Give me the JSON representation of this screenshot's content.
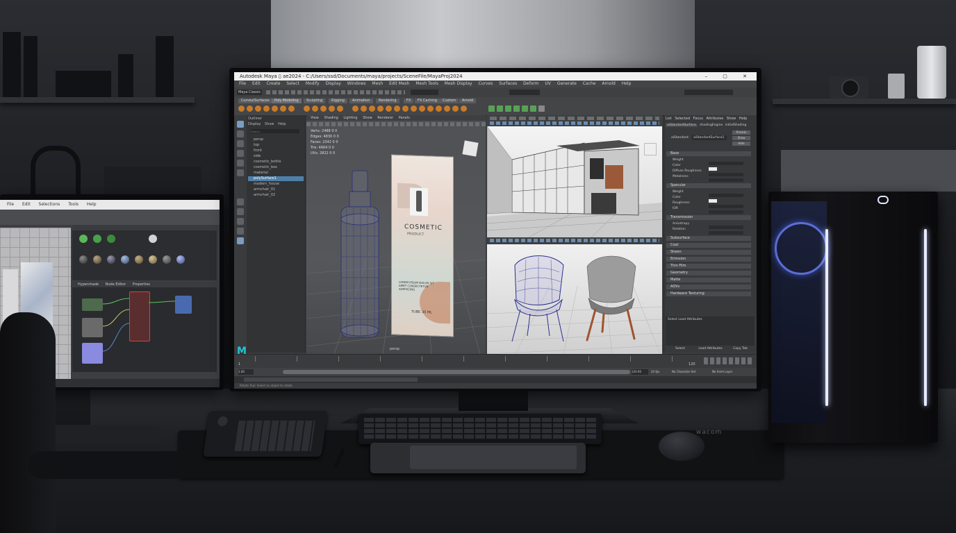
{
  "main_app": {
    "title_bar": "Autodesk Maya ▯ ae2024 - C:/Users/ssd/Documents/maya/projects/SceneFile/MayaProj2024",
    "window_controls": "–  ▢  ✕",
    "menus": [
      "File",
      "Edit",
      "Create",
      "Select",
      "Modify",
      "Display",
      "Windows",
      "Mesh",
      "Edit Mesh",
      "Mesh Tools",
      "Mesh Display",
      "Curves",
      "Surfaces",
      "Deform",
      "UV",
      "Generate",
      "Cache",
      "Arnold",
      "Help"
    ],
    "workspace": "Maya Classic",
    "shelf_tabs": [
      "Curves/Surfaces",
      "Poly Modeling",
      "Sculpting",
      "Rigging",
      "Animation",
      "Rendering",
      "FX",
      "FX Caching",
      "Custom",
      "Arnold",
      "Bifrost",
      "MASH",
      "Motion Graphics",
      "XGen"
    ],
    "logo": "M",
    "outliner": {
      "header": "Outliner",
      "menu": [
        "Display",
        "Show",
        "Help"
      ],
      "search_placeholder": "Search...",
      "items": [
        "persp",
        "top",
        "front",
        "side",
        "cosmetic_bottle",
        "cosmetic_box",
        "material",
        "polySurface1",
        "modern_house",
        "armchair_01",
        "armchair_02"
      ]
    },
    "viewport_menu": [
      "View",
      "Shading",
      "Lighting",
      "Show",
      "Renderer",
      "Panels"
    ],
    "hud_stats": [
      {
        "label": "Verts:",
        "v1": "2488",
        "v2": "0",
        "v3": "0"
      },
      {
        "label": "Edges:",
        "v1": "4830",
        "v2": "0",
        "v3": "0"
      },
      {
        "label": "Faces:",
        "v1": "2342",
        "v2": "0",
        "v3": "0"
      },
      {
        "label": "Tris:",
        "v1": "4664",
        "v2": "0",
        "v3": "0"
      },
      {
        "label": "UVs:",
        "v1": "2822",
        "v2": "0",
        "v3": "0"
      }
    ],
    "box_text": {
      "brand": "COSMETIC",
      "sub": "PRODUCT",
      "desc": "LOREM IPSUM DOLOR SIT AMET CONSECTETUR ADIPISCING",
      "footer": "TUBE 30 ML"
    },
    "viewport_label": "persp",
    "attribute_editor": {
      "tabs": [
        "List",
        "Selected",
        "Focus",
        "Attributes",
        "Show",
        "Help"
      ],
      "sub_tabs": [
        "aiStandardSurface",
        "shadingEngine",
        "initialShading"
      ],
      "material_label": "aiStandard:",
      "material_name": "aiStandardSurface1",
      "buttons": [
        "Presets",
        "Show",
        "Hide"
      ],
      "sections": [
        "Base",
        "Specular",
        "Transmission",
        "Subsurface",
        "Coat",
        "Sheen",
        "Emission",
        "Thin Film",
        "Geometry",
        "Matte",
        "AOVs",
        "Hardware Texturing"
      ],
      "rows": [
        "Weight",
        "Color",
        "Diffuse Roughness",
        "Metalness",
        "Weight",
        "Color",
        "Roughness",
        "IOR",
        "Anisotropy",
        "Rotation"
      ],
      "bottom_label": "Select Load Attributes",
      "bottom_buttons": [
        "Select",
        "Load Attributes",
        "Copy Tab"
      ]
    },
    "timeline_start": "1",
    "timeline_end": "120",
    "range_start": "1.00",
    "range_end": "120.00",
    "fps": "24 fps",
    "char_set": "No Character Set",
    "anim_layer": "No Anim Layer",
    "help_line": "Rotate Tool: Select an object to rotate."
  },
  "left_app": {
    "menus": [
      "File",
      "Edit",
      "Selections",
      "Tools",
      "Help"
    ],
    "panels": [
      "Hypershade",
      "Node Editor",
      "Properties"
    ]
  },
  "peripherals": {
    "tablet_brand": "wacom"
  },
  "colors": {
    "maya_bg": "#3b3c3f",
    "accent_blue": "#4e7fa8",
    "tower_led": "#e8ecff"
  }
}
